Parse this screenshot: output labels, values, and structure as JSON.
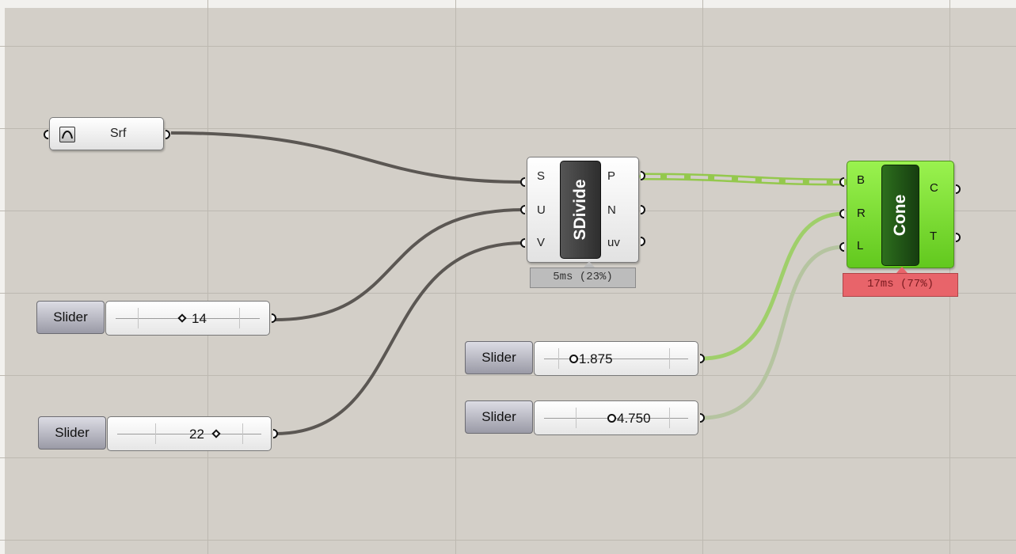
{
  "colors": {
    "canvas": "#d3cfc8",
    "wire": "#5b5753",
    "selected_wire": "#8dc63f",
    "selected_component": "#77dd2f",
    "timing_normal": "#bcbcbc",
    "timing_warning": "#e8646a"
  },
  "surface_param": {
    "label": "Srf",
    "icon": "surface-icon"
  },
  "sdivide": {
    "name": "SDivide",
    "inputs": [
      "S",
      "U",
      "V"
    ],
    "outputs": [
      "P",
      "N",
      "uv"
    ],
    "timing": "5ms (23%)"
  },
  "cone": {
    "name": "Cone",
    "inputs": [
      "B",
      "R",
      "L"
    ],
    "outputs": [
      "C",
      "T"
    ],
    "timing": "17ms (77%)"
  },
  "sliders": [
    {
      "label": "Slider",
      "value": "14"
    },
    {
      "label": "Slider",
      "value": "22"
    },
    {
      "label": "Slider",
      "value": "1.875"
    },
    {
      "label": "Slider",
      "value": "4.750"
    }
  ]
}
